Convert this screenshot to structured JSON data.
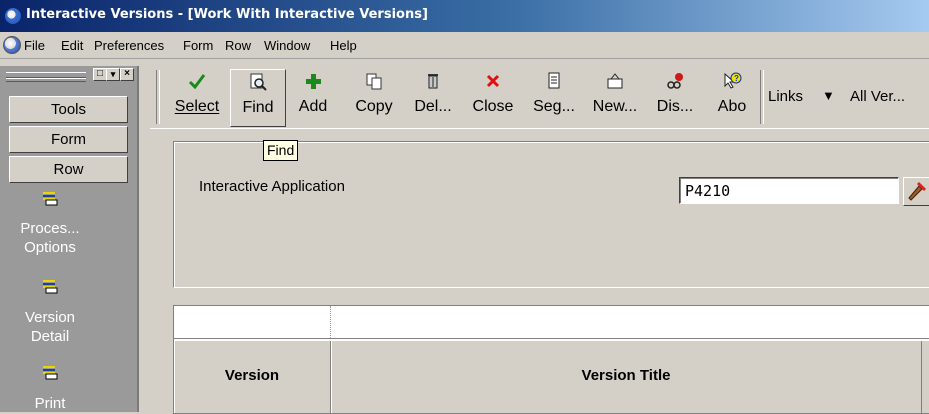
{
  "window": {
    "title": "Interactive Versions - [Work With Interactive Versions]"
  },
  "menu": {
    "items": [
      "File",
      "Edit",
      "Preferences",
      "Form",
      "Row",
      "Window",
      "Help"
    ]
  },
  "left_panel": {
    "buttons": [
      "Tools",
      "Form",
      "Row"
    ],
    "links": [
      {
        "label_line1": "Proces...",
        "label_line2": "Options",
        "icon": "processing-options-icon"
      },
      {
        "label_line1": "Version",
        "label_line2": "Detail",
        "icon": "version-detail-icon"
      },
      {
        "label_line1": "Print",
        "label_line2": "",
        "icon": "print-icon"
      }
    ]
  },
  "toolbar": {
    "buttons": [
      {
        "label": "Select",
        "icon": "checkmark-icon",
        "color": "#1a8a1a"
      },
      {
        "label": "Find",
        "icon": "find-icon",
        "color": "#404040"
      },
      {
        "label": "Add",
        "icon": "plus-icon",
        "color": "#1a8a1a"
      },
      {
        "label": "Copy",
        "icon": "copy-icon",
        "color": "#404040"
      },
      {
        "label": "Del...",
        "icon": "trash-icon",
        "color": "#404040"
      },
      {
        "label": "Close",
        "icon": "close-icon",
        "color": "#e01010"
      },
      {
        "label": "Seg...",
        "icon": "segment-icon",
        "color": "#404040"
      },
      {
        "label": "New...",
        "icon": "new-folder-icon",
        "color": "#404040"
      },
      {
        "label": "Dis...",
        "icon": "display-icon",
        "color": "#d01818"
      },
      {
        "label": "Abo",
        "icon": "about-icon",
        "color": "#1030a0"
      }
    ],
    "links_label": "Links",
    "all_versions_label": "All Ver..."
  },
  "tooltip": {
    "text": "Find"
  },
  "criteria": {
    "label": "Interactive Application",
    "value": "P4210"
  },
  "grid": {
    "columns": [
      "Version",
      "Version Title"
    ]
  }
}
